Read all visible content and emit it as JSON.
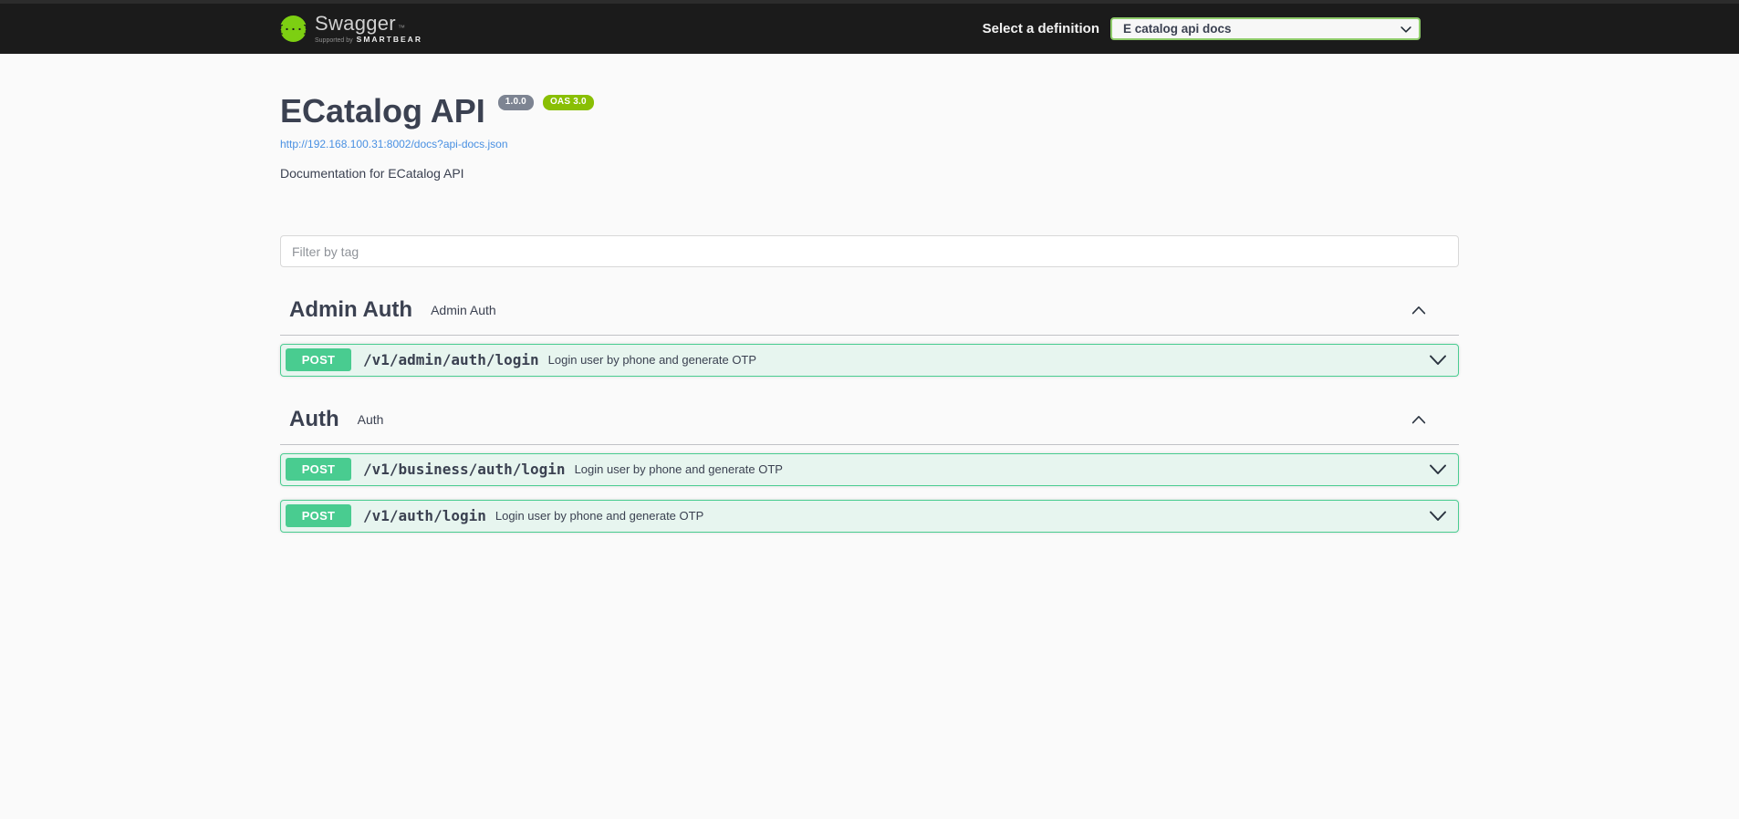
{
  "topbar": {
    "logo": {
      "brand": "Swagger",
      "trademark": "™",
      "supported_by_prefix": "Supported by",
      "supported_by_brand": "SMARTBEAR"
    },
    "select_definition": {
      "label": "Select a definition",
      "selected": "E catalog api docs"
    }
  },
  "info": {
    "title": "ECatalog API",
    "version_badge": "1.0.0",
    "oas_badge": "OAS 3.0",
    "spec_url": "http://192.168.100.31:8002/docs?api-docs.json",
    "description": "Documentation for ECatalog API"
  },
  "filter": {
    "placeholder": "Filter by tag"
  },
  "sections": [
    {
      "tag": "Admin Auth",
      "description": "Admin Auth",
      "expanded": true,
      "operations": [
        {
          "method": "POST",
          "path": "/v1/admin/auth/login",
          "summary": "Login user by phone and generate OTP"
        }
      ]
    },
    {
      "tag": "Auth",
      "description": "Auth",
      "expanded": true,
      "operations": [
        {
          "method": "POST",
          "path": "/v1/business/auth/login",
          "summary": "Login user by phone and generate OTP"
        },
        {
          "method": "POST",
          "path": "/v1/auth/login",
          "summary": "Login user by phone and generate OTP"
        }
      ]
    }
  ],
  "colors": {
    "topbar_bg": "#1b1b1b",
    "page_bg": "#fafafa",
    "logo_green": "#7dcf12",
    "select_border": "#8ecb6a",
    "post_green": "#49cc90",
    "post_bg": "rgba(73,204,144,0.1)",
    "version_badge_bg": "#7d8492",
    "oas_badge_bg": "#89bf04",
    "link_color": "#4990e2"
  }
}
